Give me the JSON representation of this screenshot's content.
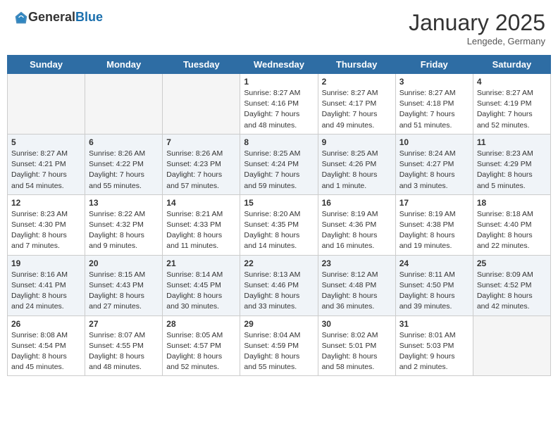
{
  "header": {
    "logo_general": "General",
    "logo_blue": "Blue",
    "month_title": "January 2025",
    "location": "Lengede, Germany"
  },
  "weekdays": [
    "Sunday",
    "Monday",
    "Tuesday",
    "Wednesday",
    "Thursday",
    "Friday",
    "Saturday"
  ],
  "weeks": [
    [
      {
        "day": "",
        "sunrise": "",
        "sunset": "",
        "daylight": ""
      },
      {
        "day": "",
        "sunrise": "",
        "sunset": "",
        "daylight": ""
      },
      {
        "day": "",
        "sunrise": "",
        "sunset": "",
        "daylight": ""
      },
      {
        "day": "1",
        "sunrise": "Sunrise: 8:27 AM",
        "sunset": "Sunset: 4:16 PM",
        "daylight": "Daylight: 7 hours and 48 minutes."
      },
      {
        "day": "2",
        "sunrise": "Sunrise: 8:27 AM",
        "sunset": "Sunset: 4:17 PM",
        "daylight": "Daylight: 7 hours and 49 minutes."
      },
      {
        "day": "3",
        "sunrise": "Sunrise: 8:27 AM",
        "sunset": "Sunset: 4:18 PM",
        "daylight": "Daylight: 7 hours and 51 minutes."
      },
      {
        "day": "4",
        "sunrise": "Sunrise: 8:27 AM",
        "sunset": "Sunset: 4:19 PM",
        "daylight": "Daylight: 7 hours and 52 minutes."
      }
    ],
    [
      {
        "day": "5",
        "sunrise": "Sunrise: 8:27 AM",
        "sunset": "Sunset: 4:21 PM",
        "daylight": "Daylight: 7 hours and 54 minutes."
      },
      {
        "day": "6",
        "sunrise": "Sunrise: 8:26 AM",
        "sunset": "Sunset: 4:22 PM",
        "daylight": "Daylight: 7 hours and 55 minutes."
      },
      {
        "day": "7",
        "sunrise": "Sunrise: 8:26 AM",
        "sunset": "Sunset: 4:23 PM",
        "daylight": "Daylight: 7 hours and 57 minutes."
      },
      {
        "day": "8",
        "sunrise": "Sunrise: 8:25 AM",
        "sunset": "Sunset: 4:24 PM",
        "daylight": "Daylight: 7 hours and 59 minutes."
      },
      {
        "day": "9",
        "sunrise": "Sunrise: 8:25 AM",
        "sunset": "Sunset: 4:26 PM",
        "daylight": "Daylight: 8 hours and 1 minute."
      },
      {
        "day": "10",
        "sunrise": "Sunrise: 8:24 AM",
        "sunset": "Sunset: 4:27 PM",
        "daylight": "Daylight: 8 hours and 3 minutes."
      },
      {
        "day": "11",
        "sunrise": "Sunrise: 8:23 AM",
        "sunset": "Sunset: 4:29 PM",
        "daylight": "Daylight: 8 hours and 5 minutes."
      }
    ],
    [
      {
        "day": "12",
        "sunrise": "Sunrise: 8:23 AM",
        "sunset": "Sunset: 4:30 PM",
        "daylight": "Daylight: 8 hours and 7 minutes."
      },
      {
        "day": "13",
        "sunrise": "Sunrise: 8:22 AM",
        "sunset": "Sunset: 4:32 PM",
        "daylight": "Daylight: 8 hours and 9 minutes."
      },
      {
        "day": "14",
        "sunrise": "Sunrise: 8:21 AM",
        "sunset": "Sunset: 4:33 PM",
        "daylight": "Daylight: 8 hours and 11 minutes."
      },
      {
        "day": "15",
        "sunrise": "Sunrise: 8:20 AM",
        "sunset": "Sunset: 4:35 PM",
        "daylight": "Daylight: 8 hours and 14 minutes."
      },
      {
        "day": "16",
        "sunrise": "Sunrise: 8:19 AM",
        "sunset": "Sunset: 4:36 PM",
        "daylight": "Daylight: 8 hours and 16 minutes."
      },
      {
        "day": "17",
        "sunrise": "Sunrise: 8:19 AM",
        "sunset": "Sunset: 4:38 PM",
        "daylight": "Daylight: 8 hours and 19 minutes."
      },
      {
        "day": "18",
        "sunrise": "Sunrise: 8:18 AM",
        "sunset": "Sunset: 4:40 PM",
        "daylight": "Daylight: 8 hours and 22 minutes."
      }
    ],
    [
      {
        "day": "19",
        "sunrise": "Sunrise: 8:16 AM",
        "sunset": "Sunset: 4:41 PM",
        "daylight": "Daylight: 8 hours and 24 minutes."
      },
      {
        "day": "20",
        "sunrise": "Sunrise: 8:15 AM",
        "sunset": "Sunset: 4:43 PM",
        "daylight": "Daylight: 8 hours and 27 minutes."
      },
      {
        "day": "21",
        "sunrise": "Sunrise: 8:14 AM",
        "sunset": "Sunset: 4:45 PM",
        "daylight": "Daylight: 8 hours and 30 minutes."
      },
      {
        "day": "22",
        "sunrise": "Sunrise: 8:13 AM",
        "sunset": "Sunset: 4:46 PM",
        "daylight": "Daylight: 8 hours and 33 minutes."
      },
      {
        "day": "23",
        "sunrise": "Sunrise: 8:12 AM",
        "sunset": "Sunset: 4:48 PM",
        "daylight": "Daylight: 8 hours and 36 minutes."
      },
      {
        "day": "24",
        "sunrise": "Sunrise: 8:11 AM",
        "sunset": "Sunset: 4:50 PM",
        "daylight": "Daylight: 8 hours and 39 minutes."
      },
      {
        "day": "25",
        "sunrise": "Sunrise: 8:09 AM",
        "sunset": "Sunset: 4:52 PM",
        "daylight": "Daylight: 8 hours and 42 minutes."
      }
    ],
    [
      {
        "day": "26",
        "sunrise": "Sunrise: 8:08 AM",
        "sunset": "Sunset: 4:54 PM",
        "daylight": "Daylight: 8 hours and 45 minutes."
      },
      {
        "day": "27",
        "sunrise": "Sunrise: 8:07 AM",
        "sunset": "Sunset: 4:55 PM",
        "daylight": "Daylight: 8 hours and 48 minutes."
      },
      {
        "day": "28",
        "sunrise": "Sunrise: 8:05 AM",
        "sunset": "Sunset: 4:57 PM",
        "daylight": "Daylight: 8 hours and 52 minutes."
      },
      {
        "day": "29",
        "sunrise": "Sunrise: 8:04 AM",
        "sunset": "Sunset: 4:59 PM",
        "daylight": "Daylight: 8 hours and 55 minutes."
      },
      {
        "day": "30",
        "sunrise": "Sunrise: 8:02 AM",
        "sunset": "Sunset: 5:01 PM",
        "daylight": "Daylight: 8 hours and 58 minutes."
      },
      {
        "day": "31",
        "sunrise": "Sunrise: 8:01 AM",
        "sunset": "Sunset: 5:03 PM",
        "daylight": "Daylight: 9 hours and 2 minutes."
      },
      {
        "day": "",
        "sunrise": "",
        "sunset": "",
        "daylight": ""
      }
    ]
  ]
}
